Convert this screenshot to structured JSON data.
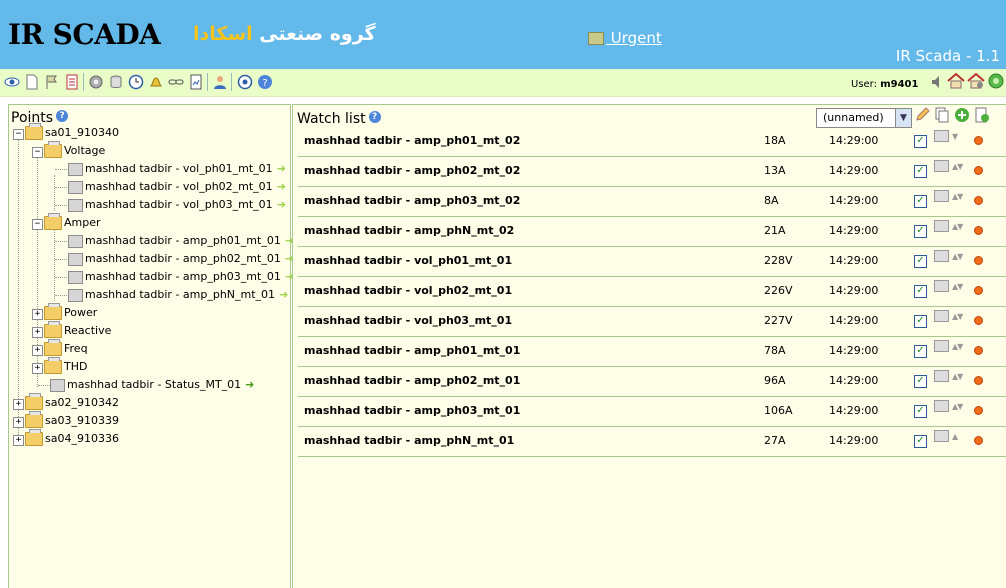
{
  "header": {
    "logo": "IR SCADA",
    "company_prefix": "گروه صنعتی ",
    "company_brand": "اسکادا",
    "urgent_label": "Urgent",
    "version": "IR Scada - 1.1"
  },
  "toolbar": {
    "icons": [
      "eye-icon",
      "page-icon",
      "flag-icon",
      "list-icon",
      "gear-icon",
      "database-icon",
      "clock-icon",
      "bell-icon",
      "link-icon",
      "report-icon",
      "user-icon",
      "stop-icon",
      "help-icon"
    ],
    "user_label": "User:",
    "user_name": "m9401"
  },
  "points": {
    "title": "Points",
    "tree": {
      "sa01": "sa01_910340",
      "voltage": "Voltage",
      "voltage_items": [
        "mashhad tadbir - vol_ph01_mt_01",
        "mashhad tadbir - vol_ph02_mt_01",
        "mashhad tadbir - vol_ph03_mt_01"
      ],
      "amper": "Amper",
      "amper_items": [
        "mashhad tadbir - amp_ph01_mt_01",
        "mashhad tadbir - amp_ph02_mt_01",
        "mashhad tadbir - amp_ph03_mt_01",
        "mashhad tadbir - amp_phN_mt_01"
      ],
      "power": "Power",
      "reactive": "Reactive",
      "freq": "Freq",
      "thd": "THD",
      "status": "mashhad tadbir - Status_MT_01",
      "sa02": "sa02_910342",
      "sa03": "sa03_910339",
      "sa04": "sa04_910336"
    }
  },
  "watchlist": {
    "title": "Watch list",
    "selected": "(unnamed)",
    "rows": [
      {
        "name": "mashhad tadbir - amp_ph01_mt_02",
        "value": "18A",
        "time": "14:29:00"
      },
      {
        "name": "mashhad tadbir - amp_ph02_mt_02",
        "value": "13A",
        "time": "14:29:00"
      },
      {
        "name": "mashhad tadbir - amp_ph03_mt_02",
        "value": "8A",
        "time": "14:29:00"
      },
      {
        "name": "mashhad tadbir - amp_phN_mt_02",
        "value": "21A",
        "time": "14:29:00"
      },
      {
        "name": "mashhad tadbir - vol_ph01_mt_01",
        "value": "228V",
        "time": "14:29:00"
      },
      {
        "name": "mashhad tadbir - vol_ph02_mt_01",
        "value": "226V",
        "time": "14:29:00"
      },
      {
        "name": "mashhad tadbir - vol_ph03_mt_01",
        "value": "227V",
        "time": "14:29:00"
      },
      {
        "name": "mashhad tadbir - amp_ph01_mt_01",
        "value": "78A",
        "time": "14:29:00"
      },
      {
        "name": "mashhad tadbir - amp_ph02_mt_01",
        "value": "96A",
        "time": "14:29:00"
      },
      {
        "name": "mashhad tadbir - amp_ph03_mt_01",
        "value": "106A",
        "time": "14:29:00"
      },
      {
        "name": "mashhad tadbir - amp_phN_mt_01",
        "value": "27A",
        "time": "14:29:00"
      }
    ]
  },
  "colors": {
    "header": "#63b9e9",
    "toolbar": "#eafdc9",
    "panel": "#fdfde8",
    "brand": "#f6c31b"
  }
}
